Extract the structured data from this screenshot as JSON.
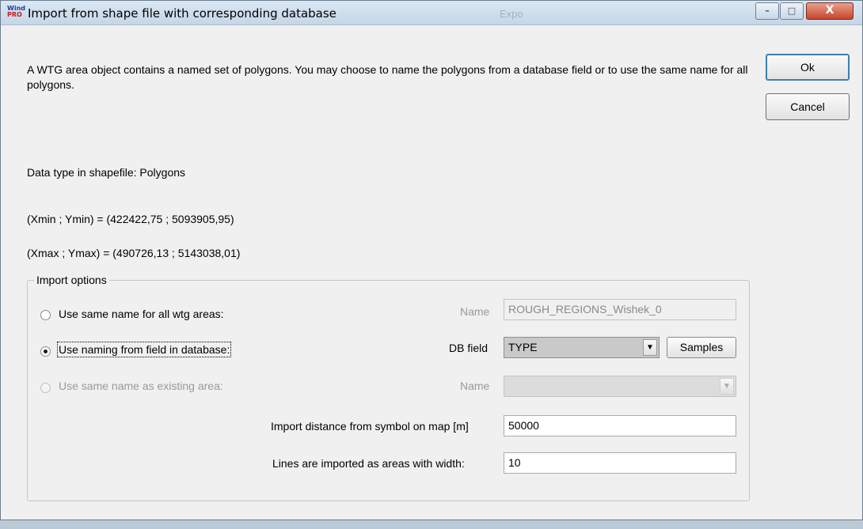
{
  "window": {
    "title": "Import from shape file with corresponding database",
    "icon_text_top": "Wind",
    "icon_text_bottom": "PRO",
    "background_text": "Expo",
    "controls": {
      "minimize": "–",
      "maximize": "□",
      "close": "X"
    }
  },
  "description": "A WTG area object contains a named set of polygons. You may choose to name the polygons from a database field or to use the same name for all polygons.",
  "buttons": {
    "ok": "Ok",
    "cancel": "Cancel"
  },
  "info": {
    "data_type": "Data type in shapefile: Polygons",
    "min": "(Xmin ; Ymin) = (422422,75 ; 5093905,95)",
    "max": "(Xmax ; Ymax) = (490726,13 ; 5143038,01)"
  },
  "import_options": {
    "label": "Import options",
    "option1": {
      "label": "Use same name for all wtg areas:",
      "checked": false,
      "enabled": true,
      "field_label": "Name",
      "field_value": "ROUGH_REGIONS_Wishek_0"
    },
    "option2": {
      "label": "Use naming from field in database:",
      "checked": true,
      "enabled": true,
      "field_label": "DB field",
      "field_value": "TYPE",
      "samples_label": "Samples"
    },
    "option3": {
      "label": "Use same name as existing area:",
      "checked": false,
      "enabled": false,
      "field_label": "Name",
      "field_value": ""
    },
    "distance": {
      "label": "Import distance from symbol on map [m]",
      "value": "50000"
    },
    "width": {
      "label": "Lines are imported as areas with width:",
      "value": "10"
    }
  },
  "colors": {
    "window_bg": "#f0f0f0",
    "titlebar": "#c5d6e8",
    "close_button": "#c8432a"
  }
}
